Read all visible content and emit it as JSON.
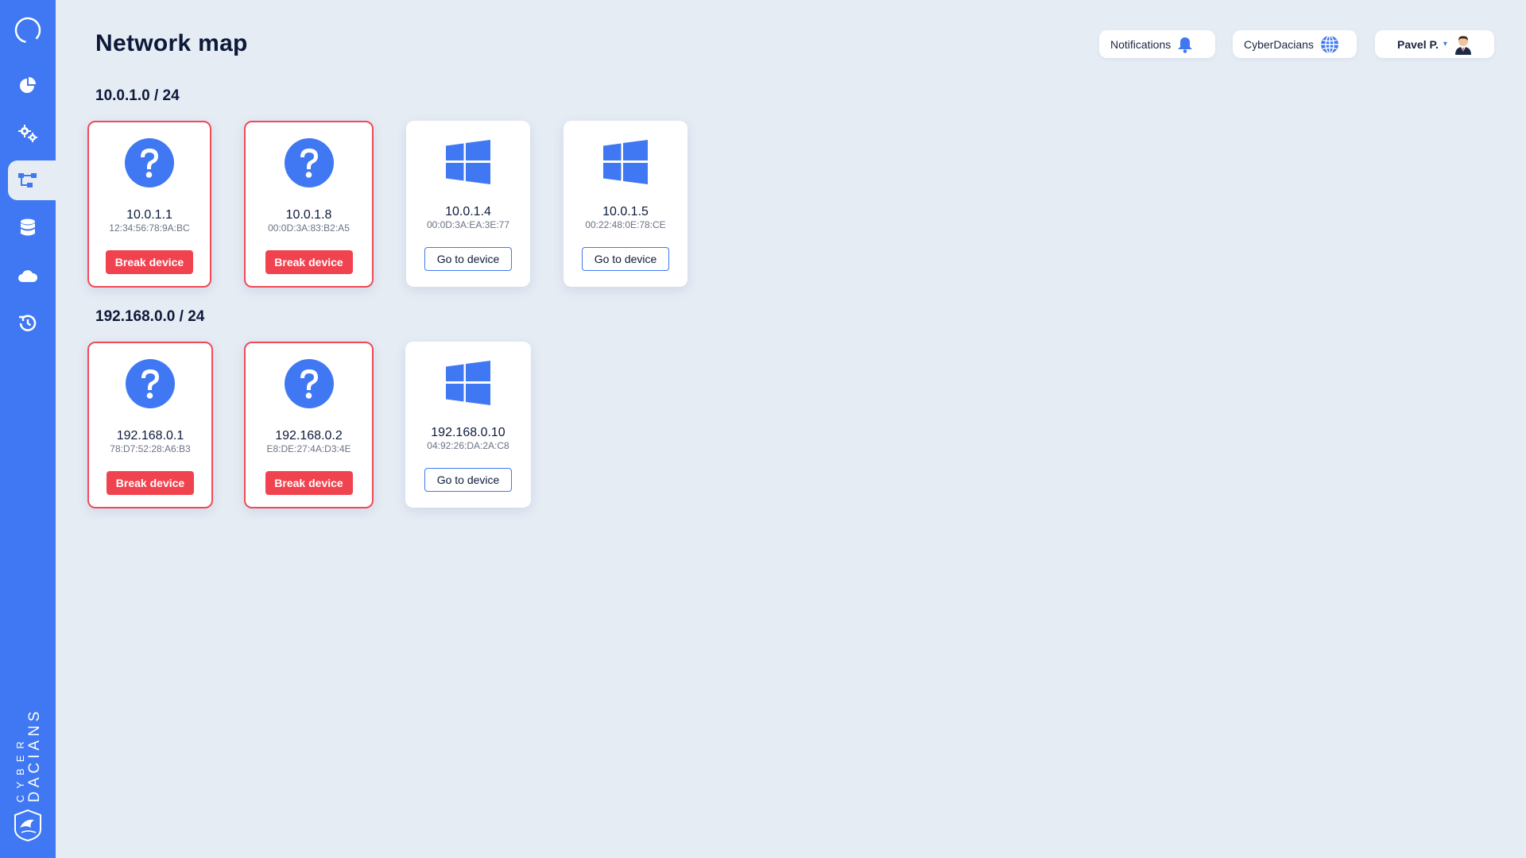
{
  "page": {
    "title": "Network map"
  },
  "header": {
    "notifications_label": "Notifications",
    "org_label": "CyberDacians",
    "user_label": "Pavel P."
  },
  "sidebar": {
    "items": [
      {
        "name": "dashboard",
        "icon": "pie-chart-icon",
        "active": false
      },
      {
        "name": "settings",
        "icon": "gears-icon",
        "active": false
      },
      {
        "name": "network-map",
        "icon": "network-icon",
        "active": true
      },
      {
        "name": "database",
        "icon": "database-icon",
        "active": false
      },
      {
        "name": "cloud",
        "icon": "cloud-icon",
        "active": false
      },
      {
        "name": "history",
        "icon": "history-icon",
        "active": false
      }
    ],
    "brand_line1": "CYBER",
    "brand_line2": "DACIANS"
  },
  "subnets": [
    {
      "title": "10.0.1.0 / 24",
      "devices": [
        {
          "type": "unknown",
          "ip": "10.0.1.1",
          "mac": "12:34:56:78:9A:BC",
          "action": "Break device"
        },
        {
          "type": "unknown",
          "ip": "10.0.1.8",
          "mac": "00:0D:3A:83:B2:A5",
          "action": "Break device"
        },
        {
          "type": "windows",
          "ip": "10.0.1.4",
          "mac": "00:0D:3A:EA:3E:77",
          "action": "Go to device"
        },
        {
          "type": "windows",
          "ip": "10.0.1.5",
          "mac": "00:22:48:0E:78:CE",
          "action": "Go to device"
        }
      ]
    },
    {
      "title": "192.168.0.0 / 24",
      "devices": [
        {
          "type": "unknown",
          "ip": "192.168.0.1",
          "mac": "78:D7:52:28:A6:B3",
          "action": "Break device"
        },
        {
          "type": "unknown",
          "ip": "192.168.0.2",
          "mac": "E8:DE:27:4A:D3:4E",
          "action": "Break device"
        },
        {
          "type": "windows",
          "ip": "192.168.0.10",
          "mac": "04:92:26:DA:2A:C8",
          "action": "Go to device"
        }
      ]
    }
  ],
  "colors": {
    "accent": "#3f78f2",
    "danger": "#f0434f",
    "background": "#e6ecf4"
  }
}
